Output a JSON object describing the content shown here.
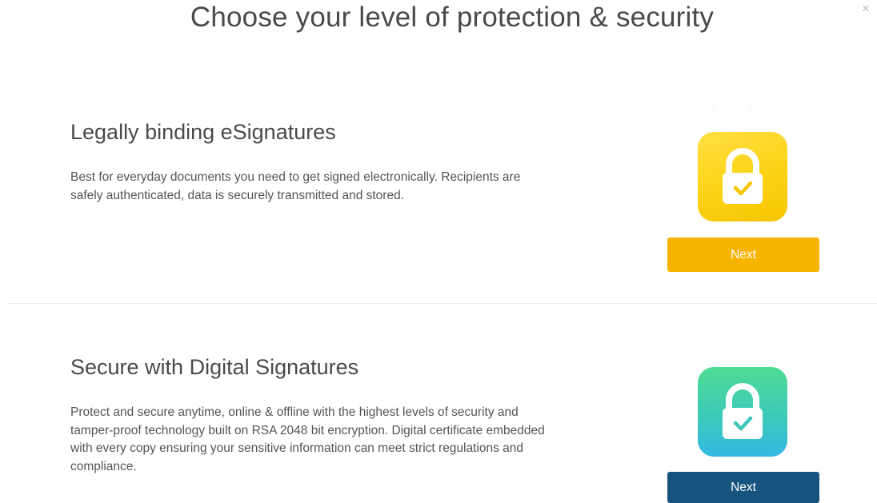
{
  "header": {
    "title": "Choose your level of protection & security",
    "close_label": "×"
  },
  "options": [
    {
      "title": "Legally binding eSignatures",
      "description": "Best for everyday documents you need to get signed electronically. Recipients are safely authenticated, data is securely transmitted and stored.",
      "icon": "lock-check-icon",
      "icon_color": "#fcd214",
      "button_label": "Next",
      "button_color": "#f6b400"
    },
    {
      "title": "Secure with Digital Signatures",
      "description": "Protect and secure anytime, online & offline with the highest levels of security and tamper-proof technology built on RSA 2048 bit encryption. Digital certificate embedded with every copy ensuring your sensitive information can meet strict regulations and compliance.",
      "icon": "lock-check-icon",
      "icon_color": "#3ccab9",
      "button_label": "Next",
      "button_color": "#17537f"
    }
  ]
}
